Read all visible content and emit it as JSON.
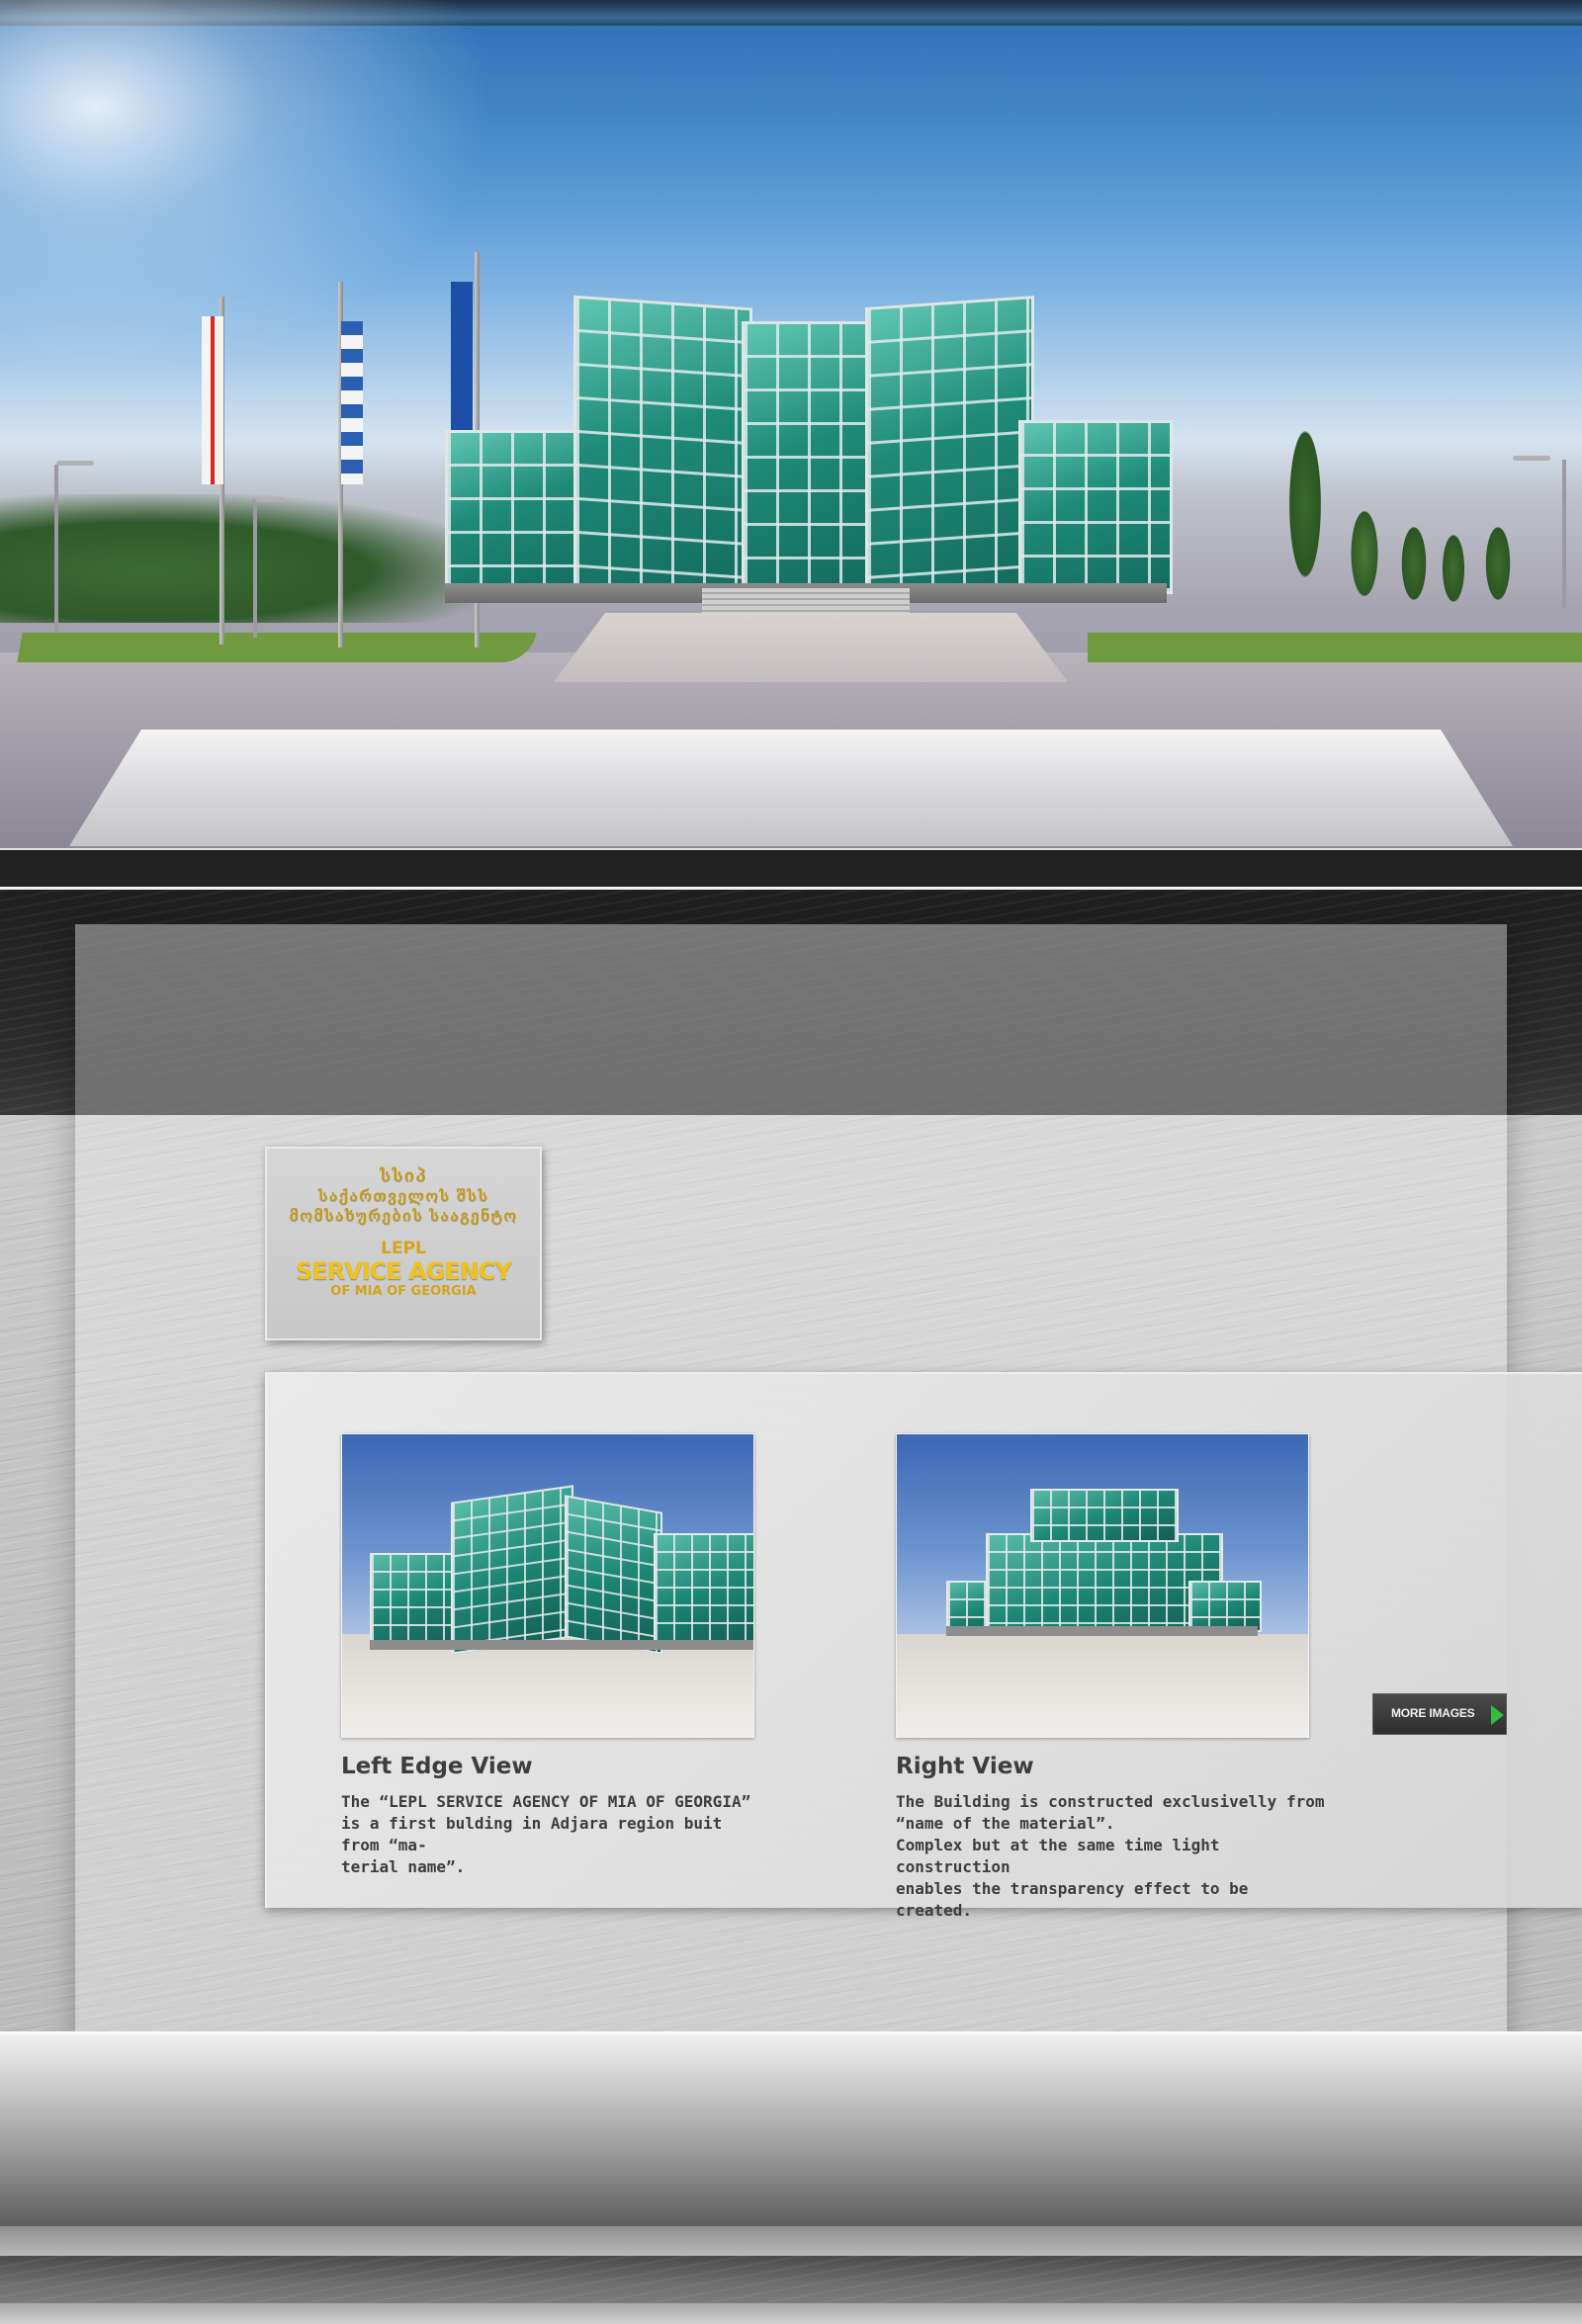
{
  "logo": {
    "ka_line1": "სსიპ",
    "ka_line2": "საქართველოს შსს",
    "ka_line3": "მომსახურების სააგენტო",
    "en_line1": "LEPL",
    "en_line2": "SERVICE AGENCY",
    "en_line3": "OF MIA OF GEORGIA"
  },
  "gallery": {
    "items": [
      {
        "title": "Left Edge View",
        "text": "The “LEPL SERVICE AGENCY OF MIA OF GEORGIA”\nis a first bulding in Adjara region buit from “ma-\nterial name”."
      },
      {
        "title": "Right View",
        "text": "The Building is constructed exclusivelly from\n“name of the material”.\nComplex but at the same time light construction\nenables the transparency effect to be created."
      }
    ],
    "more_label": "MORE IMAGES"
  },
  "colors": {
    "accent_gold": "#f0c21c",
    "arrow_green": "#2fbf3c"
  }
}
